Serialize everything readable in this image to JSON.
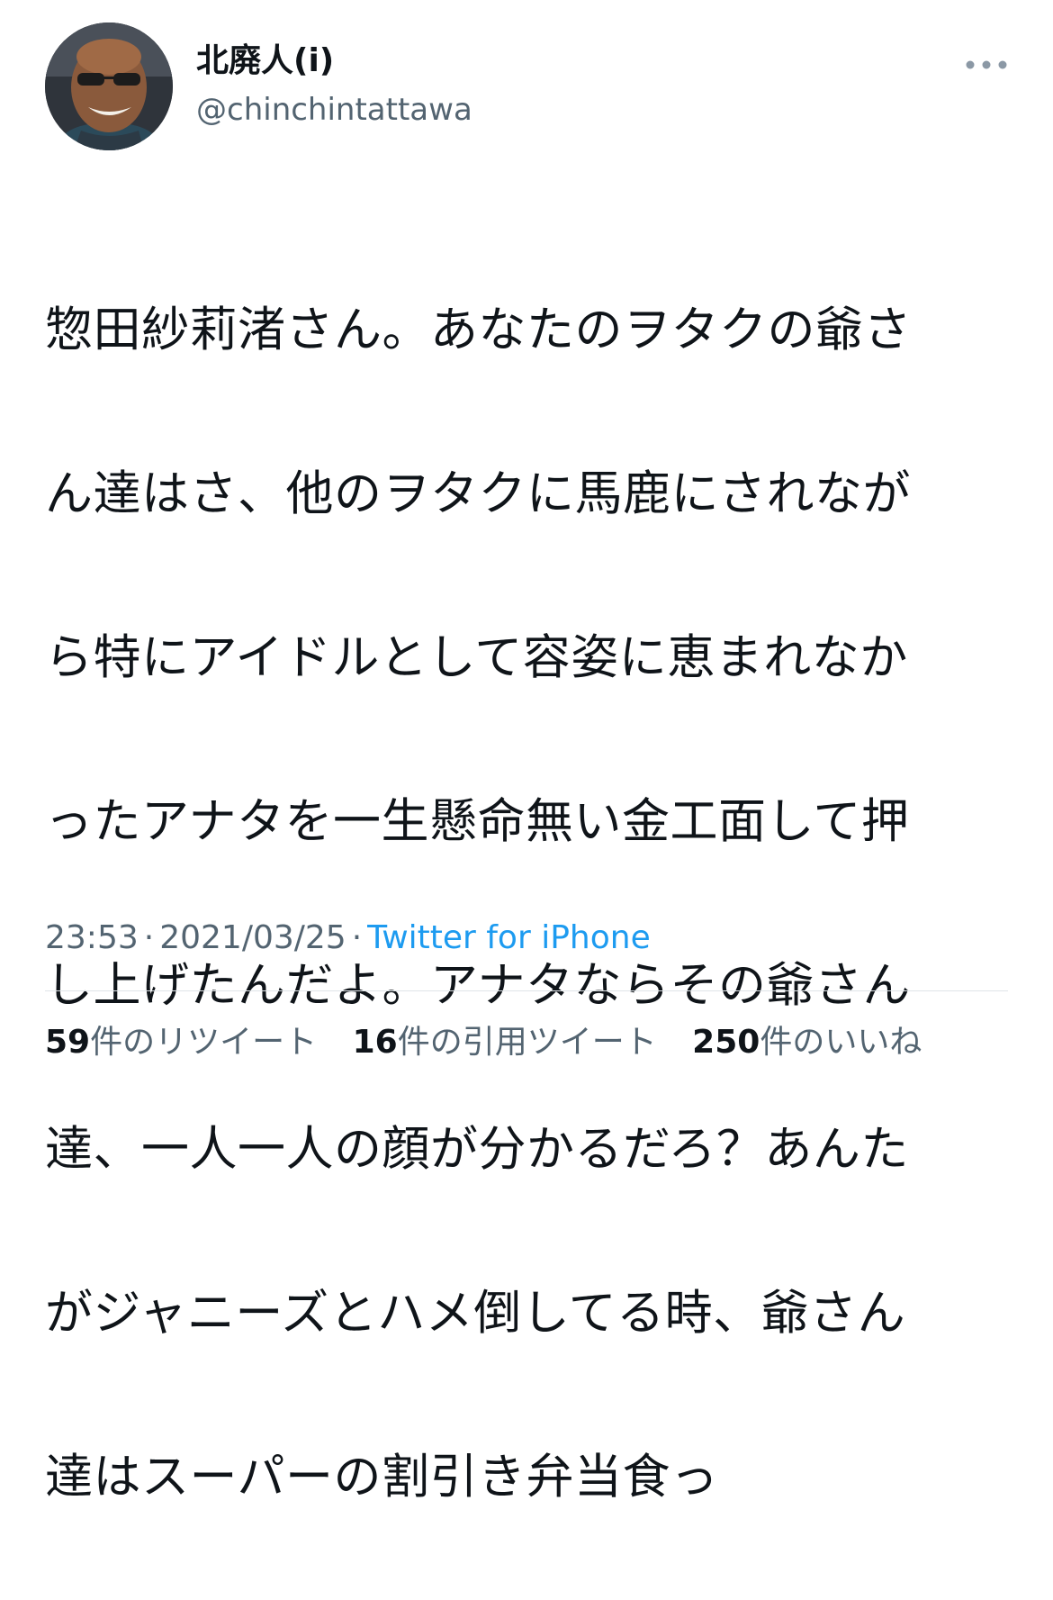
{
  "user": {
    "display_name": "北廃人(i)",
    "handle": "@chinchintattawa",
    "avatar_icon": "profile-photo-icon"
  },
  "more_icon": "more-dots-icon",
  "tweet": {
    "text_lines": [
      "惣田紗莉渚さん。あなたのヲタクの爺さ",
      "ん達はさ、他のヲタクに馬鹿にされなが",
      "ら特にアイドルとして容姿に恵まれなか",
      "ったアナタを一生懸命無い金工面して押",
      "し上げたんだよ。アナタならその爺さん",
      "達、一人一人の顔が分かるだろ？あんた",
      "がジャニーズとハメ倒してる時、爺さん",
      "達はスーパーの割引き弁当食っ"
    ],
    "time": "23:53",
    "separator": "·",
    "date": "2021/03/25",
    "source": "Twitter for iPhone"
  },
  "stats": {
    "retweets_count": "59",
    "retweets_label": "件のリツイート",
    "quotes_count": "16",
    "quotes_label": "件の引用ツイート",
    "likes_count": "250",
    "likes_label": "件のいいね"
  },
  "colors": {
    "text": "#0f1419",
    "secondary": "#536471",
    "link": "#1d9bf0",
    "divider": "#dfe4e8"
  }
}
